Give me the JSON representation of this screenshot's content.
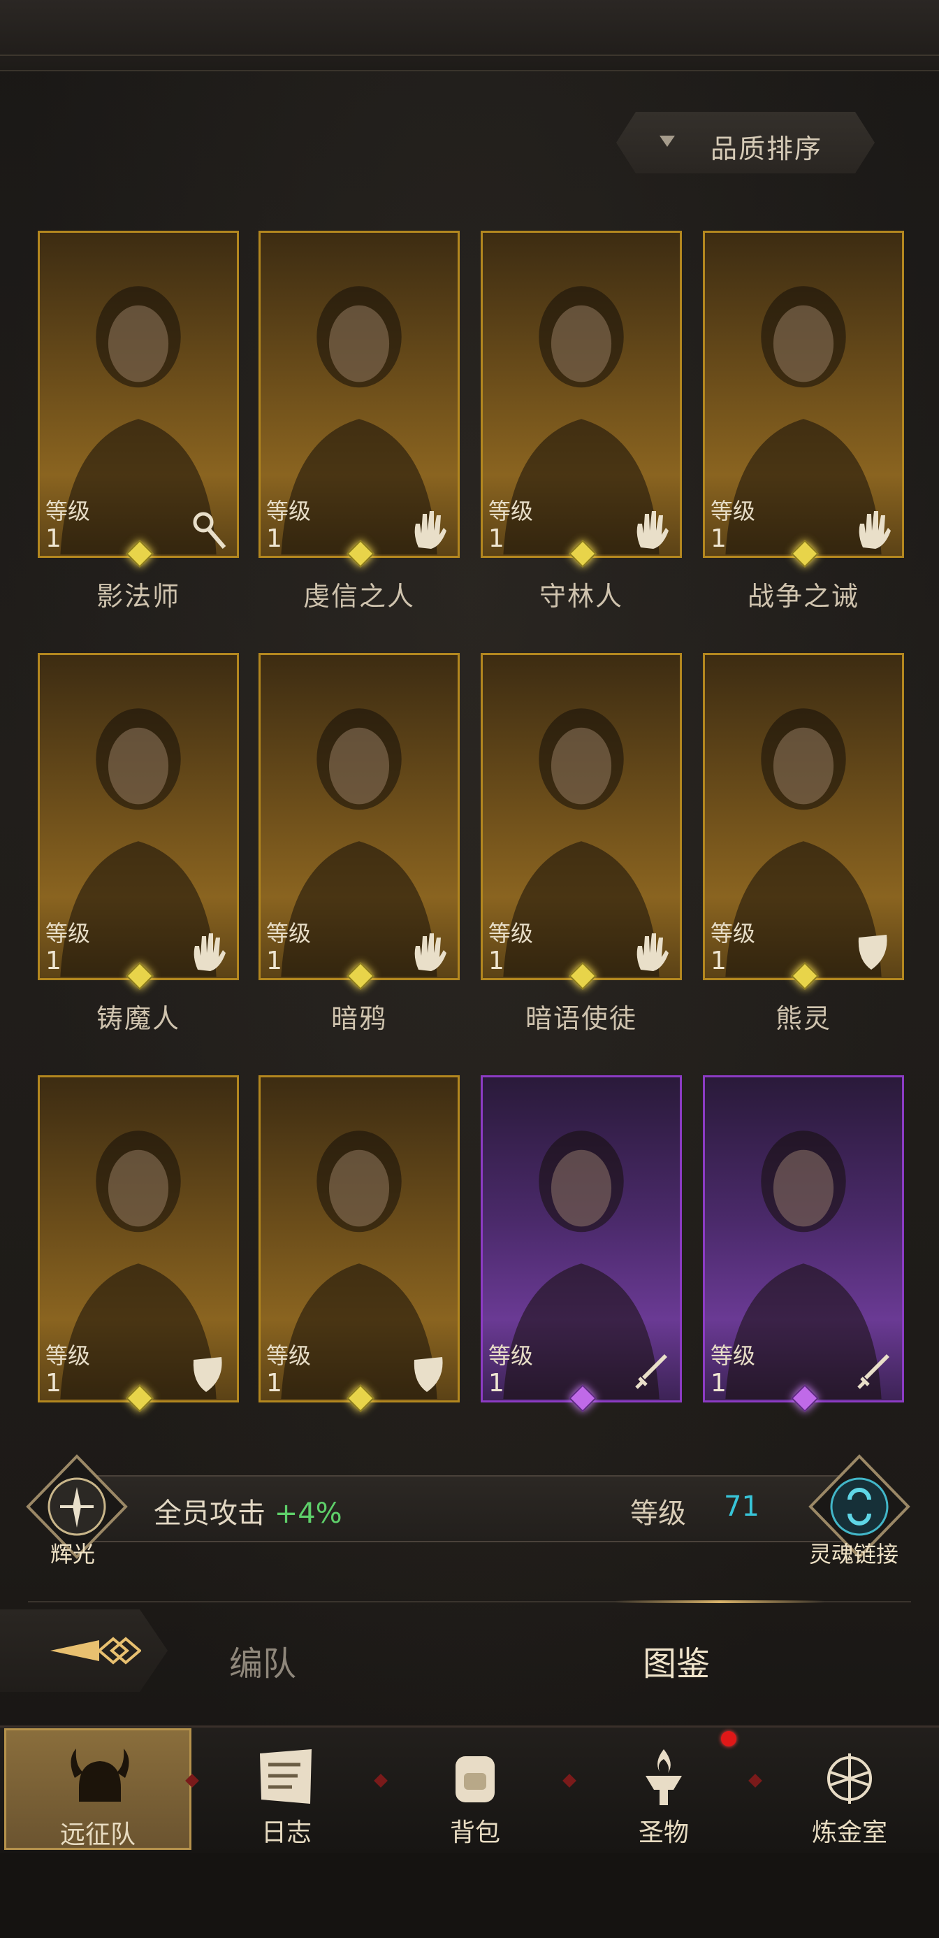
{
  "sort": {
    "label": "品质排序"
  },
  "heroes": [
    {
      "name": "影法师",
      "level_label": "等级",
      "level": "1",
      "rarity": "gold",
      "class_icon": "staff-icon"
    },
    {
      "name": "虔信之人",
      "level_label": "等级",
      "level": "1",
      "rarity": "gold",
      "class_icon": "hand-icon"
    },
    {
      "name": "守林人",
      "level_label": "等级",
      "level": "1",
      "rarity": "gold",
      "class_icon": "hand-icon"
    },
    {
      "name": "战争之诫",
      "level_label": "等级",
      "level": "1",
      "rarity": "gold",
      "class_icon": "hand-icon"
    },
    {
      "name": "铸魔人",
      "level_label": "等级",
      "level": "1",
      "rarity": "gold",
      "class_icon": "hand-icon"
    },
    {
      "name": "暗鸦",
      "level_label": "等级",
      "level": "1",
      "rarity": "gold",
      "class_icon": "hand-icon"
    },
    {
      "name": "暗语使徒",
      "level_label": "等级",
      "level": "1",
      "rarity": "gold",
      "class_icon": "hand-icon"
    },
    {
      "name": "熊灵",
      "level_label": "等级",
      "level": "1",
      "rarity": "gold",
      "class_icon": "shield-icon"
    },
    {
      "name": "",
      "level_label": "等级",
      "level": "1",
      "rarity": "gold",
      "class_icon": "shield-icon"
    },
    {
      "name": "",
      "level_label": "等级",
      "level": "1",
      "rarity": "gold",
      "class_icon": "shield-icon"
    },
    {
      "name": "",
      "level_label": "等级",
      "level": "1",
      "rarity": "purple",
      "class_icon": "sword-icon"
    },
    {
      "name": "",
      "level_label": "等级",
      "level": "1",
      "rarity": "purple",
      "class_icon": "sword-icon"
    }
  ],
  "bonus": {
    "radiance_label": "辉光",
    "text": "全员攻击",
    "value": "+4%",
    "level_label": "等级",
    "level_value": "71",
    "soul_link_label": "灵魂链接"
  },
  "tabs": {
    "formation": "编队",
    "codex": "图鉴"
  },
  "nav": [
    {
      "label": "远征队",
      "icon": "viking-helmet-icon",
      "active": true
    },
    {
      "label": "日志",
      "icon": "scroll-icon",
      "active": false
    },
    {
      "label": "背包",
      "icon": "backpack-icon",
      "active": false
    },
    {
      "label": "圣物",
      "icon": "brazier-icon",
      "active": false,
      "badge": true
    },
    {
      "label": "炼金室",
      "icon": "alchemy-icon",
      "active": false
    }
  ],
  "colors": {
    "gold_frame": "#b3871f",
    "purple_frame": "#8c3bc4",
    "bonus_green": "#5ecf6a",
    "level_cyan": "#38c4d8"
  }
}
